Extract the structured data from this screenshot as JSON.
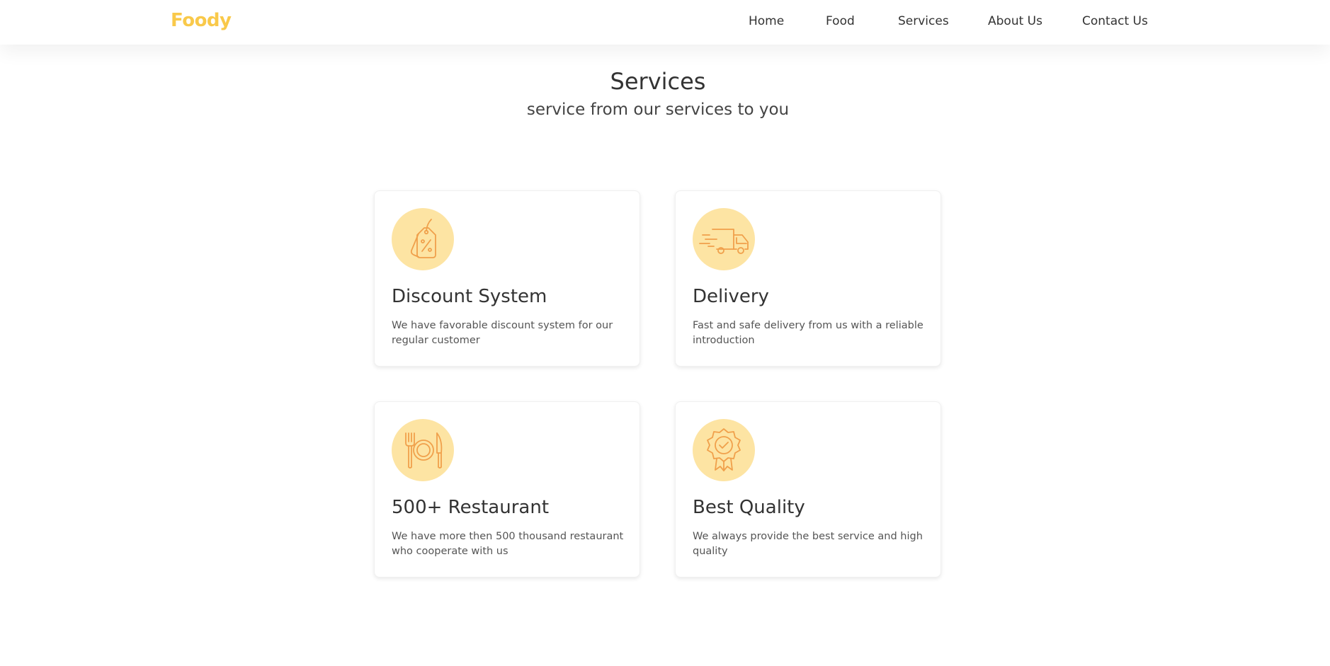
{
  "brand": {
    "name": "Foody",
    "color": "#f9c94a"
  },
  "nav": {
    "items": [
      {
        "label": "Home"
      },
      {
        "label": "Food"
      },
      {
        "label": "Services"
      },
      {
        "label": "About Us"
      },
      {
        "label": "Contact Us"
      }
    ]
  },
  "section": {
    "title": "Services",
    "subtitle": "service from our services to you"
  },
  "services": [
    {
      "icon": "discount-tag-icon",
      "title": "Discount System",
      "description": "We have favorable discount system for our regular customer"
    },
    {
      "icon": "delivery-truck-icon",
      "title": "Delivery",
      "description": "Fast and safe delivery from us with a reliable introduction"
    },
    {
      "icon": "fork-plate-knife-icon",
      "title": "500+ Restaurant",
      "description": "We have more then 500 thousand restaurant who cooperate with us"
    },
    {
      "icon": "quality-badge-icon",
      "title": "Best Quality",
      "description": "We always provide the best service and high quality"
    }
  ],
  "colors": {
    "icon_background": "#fde4a3",
    "icon_stroke": "#f0a04b",
    "text": "#333333"
  }
}
